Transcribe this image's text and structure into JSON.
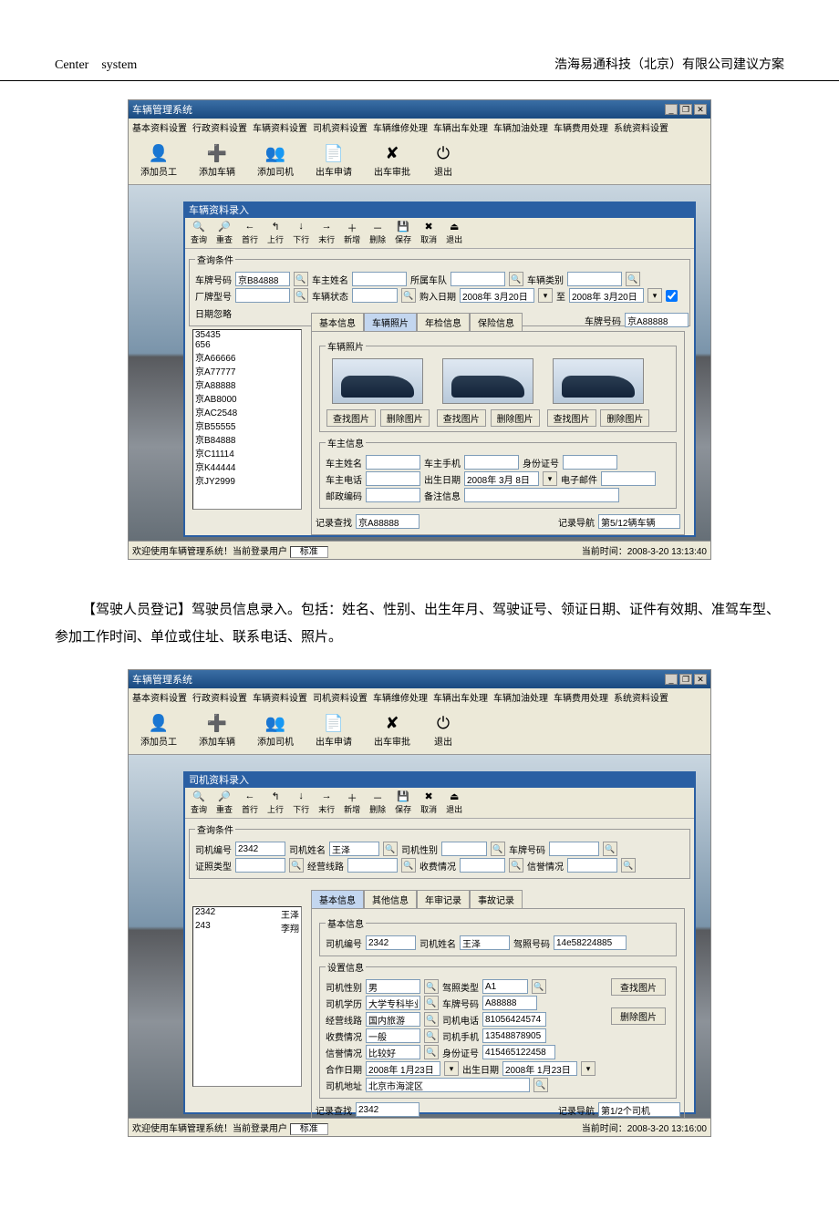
{
  "doc_header": {
    "left": "Center　system",
    "right": "浩海易通科技（北京）有限公司建议方案"
  },
  "body_paragraph": "【驾驶人员登记】驾驶员信息录入。包括：姓名、性别、出生年月、驾驶证号、领证日期、证件有效期、准驾车型、参加工作时间、单位或住址、联系电话、照片。",
  "app_title": "车辆管理系统",
  "win_buttons": [
    "_",
    "❐",
    "✕"
  ],
  "menus": [
    "基本资料设置",
    "行政资料设置",
    "车辆资料设置",
    "司机资料设置",
    "车辆维修处理",
    "车辆出车处理",
    "车辆加油处理",
    "车辆费用处理",
    "系统资料设置"
  ],
  "toolbar": [
    {
      "icon": "👤",
      "label": "添加员工"
    },
    {
      "icon": "➕",
      "label": "添加车辆"
    },
    {
      "icon": "👥",
      "label": "添加司机"
    },
    {
      "icon": "📄",
      "label": "出车申请"
    },
    {
      "icon": "✘",
      "label": "出车审批"
    },
    {
      "icon": "⏻",
      "label": "退出"
    }
  ],
  "inner_toolbar": [
    {
      "ic": "🔍",
      "lb": "查询"
    },
    {
      "ic": "🔎",
      "lb": "重查"
    },
    {
      "ic": "←",
      "lb": "首行"
    },
    {
      "ic": "↰",
      "lb": "上行"
    },
    {
      "ic": "↓",
      "lb": "下行"
    },
    {
      "ic": "→",
      "lb": "末行"
    },
    {
      "ic": "＋",
      "lb": "新增"
    },
    {
      "ic": "－",
      "lb": "删除"
    },
    {
      "ic": "💾",
      "lb": "保存"
    },
    {
      "ic": "✖",
      "lb": "取消"
    },
    {
      "ic": "⏏",
      "lb": "退出"
    }
  ],
  "screen1": {
    "panel_title": "车辆资料录入",
    "search_legend": "查询条件",
    "labels": {
      "plate": "车牌号码",
      "owner": "车主姓名",
      "team": "所属车队",
      "vtype": "车辆类别",
      "factory": "厂牌型号",
      "status": "车辆状态",
      "buydate": "购入日期",
      "to": "至",
      "ignore": "日期忽略"
    },
    "values": {
      "plate": "京B84888",
      "buydate_from": "2008年 3月20日",
      "buydate_to": "2008年 3月20日"
    },
    "list": [
      "35435",
      "656",
      "京A66666",
      "京A77777",
      "京A88888",
      "京AB8000",
      "京AC2548",
      "京B55555",
      "京B84888",
      "京C11114",
      "京K44444",
      "京JY2999"
    ],
    "tabs": [
      "基本信息",
      "车辆照片",
      "年检信息",
      "保险信息"
    ],
    "plate_right_lbl": "车牌号码",
    "plate_right_val": "京A88888",
    "photo_legend": "车辆照片",
    "photo_btns": {
      "find": "查找图片",
      "del": "删除图片"
    },
    "owner_legend": "车主信息",
    "owner_labels": {
      "name": "车主姓名",
      "mobile": "车主手机",
      "id": "身份证号",
      "tel": "车主电话",
      "birth": "出生日期",
      "email": "电子邮件",
      "zip": "邮政编码",
      "remark": "备注信息"
    },
    "owner_values": {
      "birth": "2008年 3月 8日"
    },
    "footer": {
      "search_lbl": "记录查找",
      "search_val": "京A88888",
      "nav_lbl": "记录导航",
      "nav_val": "第5/12辆车辆"
    },
    "status_left": "欢迎使用车辆管理系统！当前登录用户",
    "status_user": "标准",
    "status_right": "当前时间：2008-3-20 13:13:40"
  },
  "screen2": {
    "panel_title": "司机资料录入",
    "search_legend": "查询条件",
    "labels": {
      "driverno": "司机编号",
      "drivername": "司机姓名",
      "gender": "司机性别",
      "plate": "车牌号码",
      "lictype": "证照类型",
      "route": "经营线路",
      "charge": "收费情况",
      "credit": "信誉情况"
    },
    "values": {
      "driverno": "2342",
      "drivername": "王泽"
    },
    "list": [
      {
        "id": "2342",
        "nm": "王泽"
      },
      {
        "id": "243",
        "nm": "李翔"
      }
    ],
    "tabs": [
      "基本信息",
      "其他信息",
      "年审记录",
      "事故记录"
    ],
    "basic_legend": "基本信息",
    "basic": {
      "id_lbl": "司机编号",
      "id": "2342",
      "name_lbl": "司机姓名",
      "name": "王泽",
      "lic_lbl": "驾照号码",
      "lic": "14e58224885"
    },
    "set_legend": "设置信息",
    "set_labels": {
      "gender": "司机性别",
      "lictype": "驾照类型",
      "edu": "司机学历",
      "plate": "车牌号码",
      "route": "经营线路",
      "tel": "司机电话",
      "charge": "收费情况",
      "mobile": "司机手机",
      "credit": "信誉情况",
      "idcard": "身份证号",
      "joindate": "合作日期",
      "birth": "出生日期",
      "addr": "司机地址",
      "find": "查找图片",
      "del": "删除图片"
    },
    "set_values": {
      "gender": "男",
      "lictype": "A1",
      "edu": "大学专科毕业",
      "plate": "A88888",
      "route": "国内旅游",
      "tel": "81056424574",
      "charge": "一般",
      "mobile": "13548878905",
      "credit": "比较好",
      "idcard": "415465122458",
      "joindate": "2008年 1月23日",
      "birth": "2008年 1月23日",
      "addr": "北京市海淀区"
    },
    "footer": {
      "search_lbl": "记录查找",
      "search_val": "2342",
      "nav_lbl": "记录导航",
      "nav_val": "第1/2个司机"
    },
    "status_left": "欢迎使用车辆管理系统！当前登录用户",
    "status_user": "标准",
    "status_right": "当前时间：2008-3-20 13:16:00"
  }
}
